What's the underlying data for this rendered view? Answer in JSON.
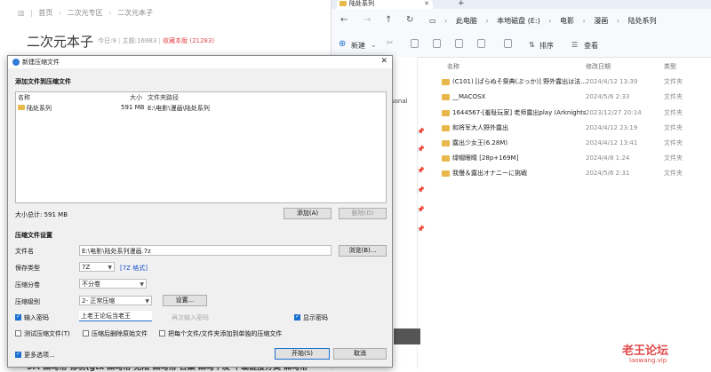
{
  "forum": {
    "breadcrumb": [
      "首页",
      "二次元专区",
      "二次元本子"
    ],
    "title": "二次元本子",
    "stats": {
      "today": "今日:9",
      "topics": "主题:16983",
      "rank": "收藏本版 (21283)"
    },
    "bottom_row": "5M 黑马帮   修羽(gtx 黑马帮   无限 黑马帮   合集 黑马下发   下载链接分类 黑马帮"
  },
  "explorer": {
    "tab_title": "陆处系列",
    "path": [
      "此电脑",
      "本地磁盘 (E:)",
      "电影",
      "漫画",
      "陆处系列"
    ],
    "toolbar": {
      "new": "新建",
      "sort": "排序",
      "view": "查看"
    },
    "columns": {
      "name": "名称",
      "date": "修改日期",
      "type": "类型"
    },
    "rows": [
      {
        "name": "(C101) [ぱらぬそ祭典(ぷっか)] 野外露出は法...",
        "date": "2024/4/12 13:39",
        "type": "文件夹"
      },
      {
        "name": "__MACOSX",
        "date": "2024/5/6 2:33",
        "type": "文件夹"
      },
      {
        "name": "1644567-[羞耻玩家] 老师露出play (Arknights...",
        "date": "2023/12/27 20:14",
        "type": "文件夹"
      },
      {
        "name": "和将军大人野外露出",
        "date": "2024/4/12 23:19",
        "type": "文件夹"
      },
      {
        "name": "露出少女王(6.28M)",
        "date": "2024/4/12 13:41",
        "type": "文件夹"
      },
      {
        "name": "绿帽眼睛 [28p+169M]",
        "date": "2024/4/8 1:24",
        "type": "文件夹"
      },
      {
        "name": "我慢＆露出オナニーに挑戦",
        "date": "2024/5/6 2:31",
        "type": "文件夹"
      }
    ],
    "side_label": "sonal"
  },
  "dialog": {
    "title": "新建压缩文件",
    "section_add": "添加文件到压缩文件",
    "list_headers": {
      "name": "名称",
      "size": "大小",
      "path": "文件夹路径"
    },
    "list_rows": [
      {
        "name": "陆处系列",
        "size": "591 MB",
        "path": "E:\\电影\\漫画\\陆处系列"
      }
    ],
    "total_size": "大小总计: 591 MB",
    "add_button": "添加(A)",
    "delete_button": "删除(D)",
    "section_settings": "压缩文件设置",
    "filename_label": "文件名",
    "filename_value": "E:\\电影\\陆处系列漫画.7z",
    "browse_button": "浏览(B)...",
    "format_label": "保存类型",
    "format_value": "7Z",
    "format_link": "[7Z 格式]",
    "split_label": "压缩分卷",
    "split_value": "不分卷",
    "level_label": "压缩级别",
    "level_value": "2- 正常压缩",
    "settings_button": "设置...",
    "password_label": "输入密码",
    "password_value": "上老王论坛当老王",
    "password_repeat_placeholder": "再次输入密码",
    "show_password_label": "显示密码",
    "test_label": "测试压缩文件(T)",
    "delete_after_label": "压缩后删除原始文件",
    "each_separate_label": "把每个文件/文件夹添加到单独的压缩文件",
    "more_options_label": "更多选项...",
    "start_button": "开始(S)",
    "cancel_button": "取消"
  },
  "watermark": {
    "main": "老王论坛",
    "sub": "laowang.vip"
  }
}
